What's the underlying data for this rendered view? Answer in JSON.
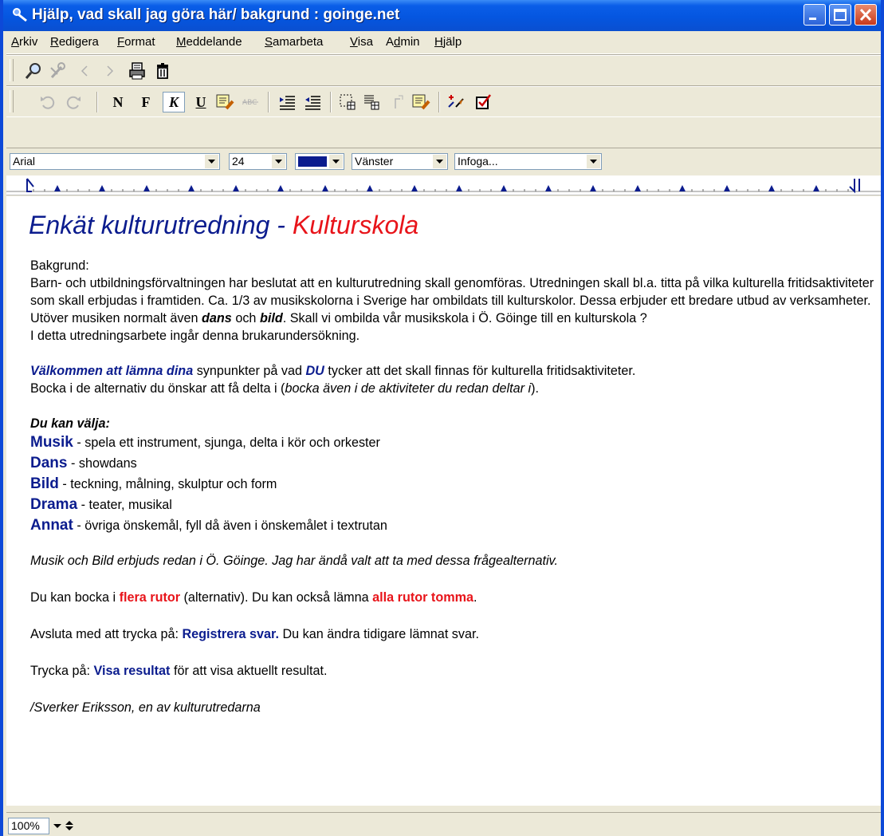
{
  "window": {
    "title": "Hjälp, vad skall jag göra här/ bakgrund : goinge.net",
    "controls": [
      "minimize",
      "maximize",
      "close"
    ]
  },
  "menu": {
    "items": [
      {
        "label": "Arkiv",
        "key": "A"
      },
      {
        "label": "Redigera",
        "key": "R"
      },
      {
        "label": "Format",
        "key": "F"
      },
      {
        "label": "Meddelande",
        "key": "M"
      },
      {
        "label": "Samarbeta",
        "key": "S"
      },
      {
        "label": "Visa",
        "key": "V"
      },
      {
        "label": "Admin",
        "key": "d"
      },
      {
        "label": "Hjälp",
        "key": "H"
      }
    ]
  },
  "toolbar1": {
    "icons": [
      "search-icon",
      "tools-icon",
      "prev-icon",
      "next-icon",
      "print-icon",
      "trash-icon"
    ]
  },
  "toolbar2": {
    "bold_label": "N",
    "fat_label": "F",
    "italic_label": "K",
    "underline_label": "U",
    "icons": [
      "undo-icon",
      "redo-icon",
      "highlight-icon",
      "strike-icon",
      "indent-icon",
      "outdent-icon",
      "table-icon",
      "table-format-icon",
      "insert-image-icon",
      "edit-image-icon",
      "spell-check-icon",
      "checkbox-icon"
    ]
  },
  "format_bar": {
    "font": "Arial",
    "size": "24",
    "color": "#0b1c8e",
    "align": "Vänster",
    "insert": "Infoga..."
  },
  "document": {
    "title_part1": "Enkät kulturutredning - ",
    "title_part2": "Kulturskola",
    "intro_label": "Bakgrund:",
    "intro_body_1": "Barn- och utbildningsförvaltningen har beslutat att en kulturutredning skall genomföras. Utredningen skall bl.a. titta på vilka kulturella fritidsaktiviteter som skall erbjudas i framtiden. Ca. 1/3 av musikskolorna i Sverige har ombildats till kulturskolor. Dessa erbjuder ett bredare utbud av verksamheter. Utöver musiken normalt även ",
    "intro_dans": "dans",
    "intro_och": " och ",
    "intro_bild": "bild",
    "intro_body_2": ". Skall vi ombilda vår musikskola i Ö. Göinge till en kulturskola ?",
    "intro_line_3": "I detta utredningsarbete ingår denna brukarundersökning.",
    "welcome_bold": "Välkommen att lämna dina",
    "welcome_mid": " synpunkter på vad ",
    "welcome_du": "DU",
    "welcome_end": " tycker att det skall finnas för kulturella fritidsaktiviteter.",
    "bocka_start": "Bocka i de alternativ du önskar att få delta i (",
    "bocka_italic": "bocka även i de aktiviteter du redan deltar i",
    "bocka_end": ").",
    "choose_heading": "Du kan välja:",
    "options": [
      {
        "name": "Musik",
        "desc": " - spela ett instrument, sjunga, delta i kör och orkester"
      },
      {
        "name": "Dans",
        "desc": " - showdans"
      },
      {
        "name": "Bild",
        "desc": " - teckning, målning, skulptur och form"
      },
      {
        "name": "Drama",
        "desc": " - teater, musikal"
      },
      {
        "name": "Annat",
        "desc": " - övriga önskemål, fyll då även i önskemålet i textrutan"
      }
    ],
    "note_italic": "Musik och Bild erbjuds redan i Ö. Göinge. Jag har ändå valt att ta med dessa frågealternativ.",
    "multi_start": "Du kan bocka i ",
    "multi_red1": "flera rutor",
    "multi_mid": " (alternativ). Du kan också lämna ",
    "multi_red2": "alla rutor tomma",
    "multi_end": ".",
    "finish_start": "Avsluta med att trycka på: ",
    "finish_bold": "Registrera svar.",
    "finish_end": " Du kan ändra tidigare lämnat svar.",
    "result_start": "Trycka på: ",
    "result_bold": "Visa resultat",
    "result_end": " för att visa aktuellt resultat.",
    "signature": "/Sverker Eriksson, en av kulturutredarna"
  },
  "status": {
    "zoom": "100%"
  }
}
